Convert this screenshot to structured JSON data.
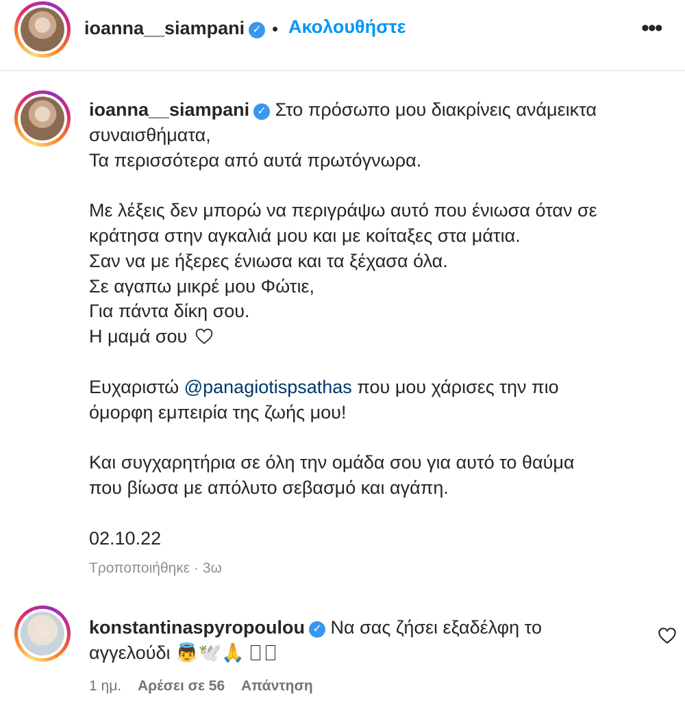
{
  "header": {
    "username": "ioanna__siampani",
    "separator": "•",
    "follow_label": "Ακολουθήστε",
    "more_label": "•••"
  },
  "caption": {
    "username": "ioanna__siampani",
    "first_line": "Στο πρόσωπο μου διακρίνεις ανάμεικτα",
    "lines_a": [
      "συναισθήματα,",
      "Τα περισσότερα από αυτά πρωτόγνωρα."
    ],
    "lines_b": [
      "Με λέξεις δεν μπορώ να περιγράψω αυτό που ένιωσα όταν σε",
      "κράτησα στην αγκαλιά μου και με κοίταξες στα μάτια.",
      "Σαν να με ήξερες ένιωσα και τα ξέχασα όλα.",
      "Σε αγαπω μικρέ μου Φώτιε,",
      "Για πάντα δίκη σου."
    ],
    "mom_line": "Η μαμά σου",
    "thanks_prefix": "Ευχαριστώ ",
    "mention": "@panagiotispsathas",
    "thanks_suffix": " που μου χάρισες την πιο",
    "thanks_line2": "όμορφη εμπειρία της ζωής μου!",
    "lines_c": [
      "Και συγχαρητήρια σε όλη την ομάδα σου για αυτό το θαύμα",
      "που βίωσα με απόλυτο σεβασμό και αγάπη."
    ],
    "date": "02.10.22",
    "edited": "Τροποποιήθηκε · 3ω"
  },
  "comment": {
    "username": "konstantinaspyropoulou",
    "text_line1": "Να σας ζήσει εξαδέλφη το",
    "text_line2": "αγγελούδι 👼🕊️🙏",
    "time": "1 ημ.",
    "likes": "Αρέσει σε 56",
    "reply": "Απάντηση"
  },
  "icons": {
    "verified": "verified-badge-icon",
    "heart": "heart-outline-icon",
    "more": "more-options-icon"
  },
  "colors": {
    "follow": "#0095f6",
    "mention": "#00376b",
    "verified": "#3897f0",
    "muted": "#8e8e8e"
  }
}
